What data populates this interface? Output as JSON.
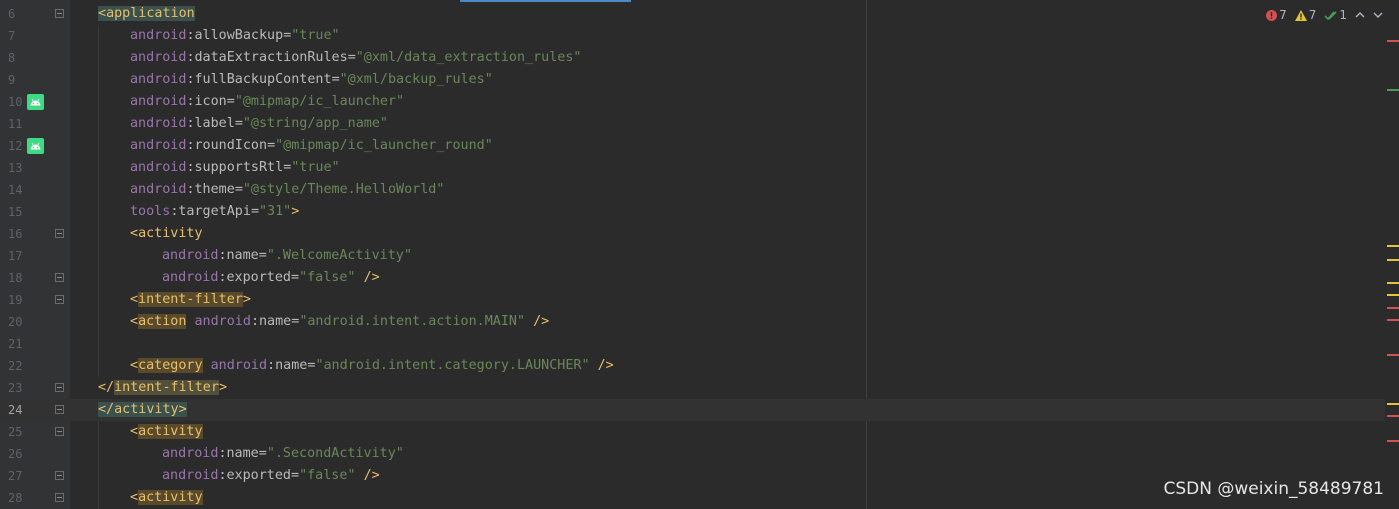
{
  "editor": {
    "lines": [
      {
        "num": "6"
      },
      {
        "num": "7"
      },
      {
        "num": "8"
      },
      {
        "num": "9"
      },
      {
        "num": "10"
      },
      {
        "num": "11"
      },
      {
        "num": "12"
      },
      {
        "num": "13"
      },
      {
        "num": "14"
      },
      {
        "num": "15"
      },
      {
        "num": "16"
      },
      {
        "num": "17"
      },
      {
        "num": "18"
      },
      {
        "num": "19"
      },
      {
        "num": "20"
      },
      {
        "num": "21"
      },
      {
        "num": "22"
      },
      {
        "num": "23"
      },
      {
        "num": "24"
      },
      {
        "num": "25"
      },
      {
        "num": "26"
      },
      {
        "num": "27"
      },
      {
        "num": "28"
      }
    ],
    "tokens": {
      "application": "application",
      "activity": "activity",
      "intent_filter": "intent-filter",
      "action": "action",
      "category": "category",
      "android": "android",
      "tools": "tools",
      "allowBackup": "allowBackup",
      "dataExtractionRules": "dataExtractionRules",
      "fullBackupContent": "fullBackupContent",
      "icon": "icon",
      "label": "label",
      "roundIcon": "roundIcon",
      "supportsRtl": "supportsRtl",
      "theme": "theme",
      "targetApi": "targetApi",
      "name": "name",
      "exported": "exported",
      "v_true": "\"true\"",
      "v_false": "\"false\"",
      "v_data_extraction": "\"@xml/data_extraction_rules\"",
      "v_backup_rules": "\"@xml/backup_rules\"",
      "v_ic_launcher": "\"@mipmap/ic_launcher\"",
      "v_app_name": "\"@string/app_name\"",
      "v_ic_launcher_round": "\"@mipmap/ic_launcher_round\"",
      "v_theme": "\"@style/Theme.HelloWorld\"",
      "v_31": "\"31\"",
      "v_welcome": "\".WelcomeActivity\"",
      "v_second": "\".SecondActivity\"",
      "v_main": "\"android.intent.action.MAIN\"",
      "v_launcher": "\"android.intent.category.LAUNCHER\""
    }
  },
  "inspections": {
    "errors": "7",
    "warnings": "7",
    "weak_warnings": "1"
  },
  "watermark": "CSDN @weixin_58489781",
  "colors": {
    "background": "#2b2b2b",
    "gutter": "#313335",
    "tag": "#e8bf6a",
    "namespace": "#9876aa",
    "string": "#6a8759",
    "attribute": "#bababa",
    "error": "#d25252",
    "warning": "#e2c33b",
    "ok": "#499c54"
  }
}
